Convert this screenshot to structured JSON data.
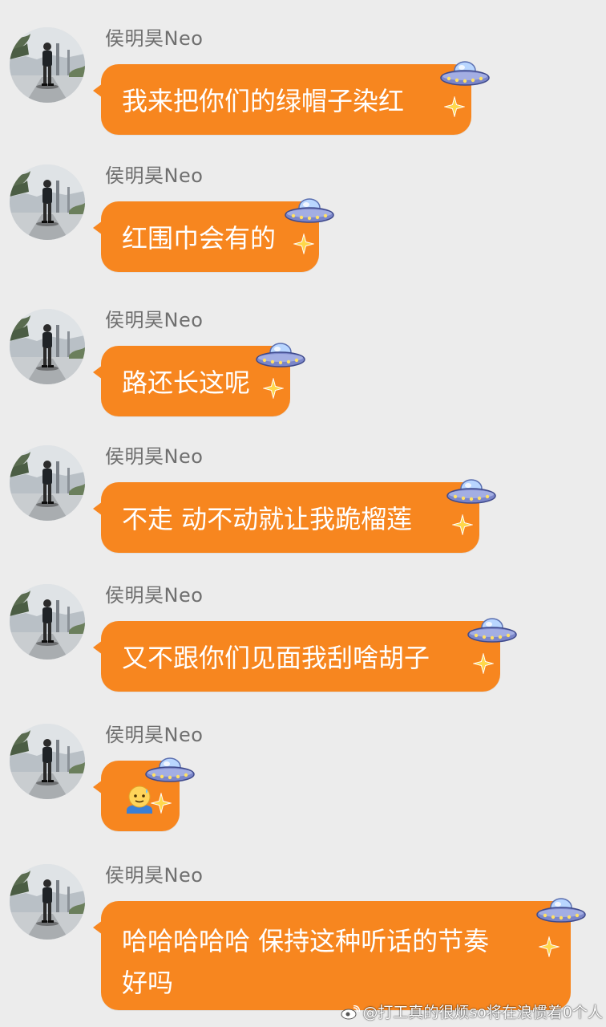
{
  "messages": [
    {
      "sender": "侯明昊Neo",
      "text": "我来把你们的绿帽子染红"
    },
    {
      "sender": "侯明昊Neo",
      "text": "红围巾会有的"
    },
    {
      "sender": "侯明昊Neo",
      "text": "路还长这呢"
    },
    {
      "sender": "侯明昊Neo",
      "text": "不走 动不动就让我跪榴莲"
    },
    {
      "sender": "侯明昊Neo",
      "text": "又不跟你们见面我刮啥胡子"
    },
    {
      "sender": "侯明昊Neo",
      "emoji": "sweating-smile-emoji"
    },
    {
      "sender": "侯明昊Neo",
      "text_line1": "哈哈哈哈哈 保持这种听话的节奏",
      "text_line2": "好吗"
    }
  ],
  "watermark": "@打工真的很烦so将在浪惯着0个人",
  "colors": {
    "bubble": "#f7861f",
    "background": "#ececec",
    "sender_name": "#6f6f6f"
  },
  "icons": {
    "bubble_decoration": "ufo-icon",
    "sparkle": "sparkle-icon",
    "watermark_logo": "weibo-logo-icon"
  }
}
